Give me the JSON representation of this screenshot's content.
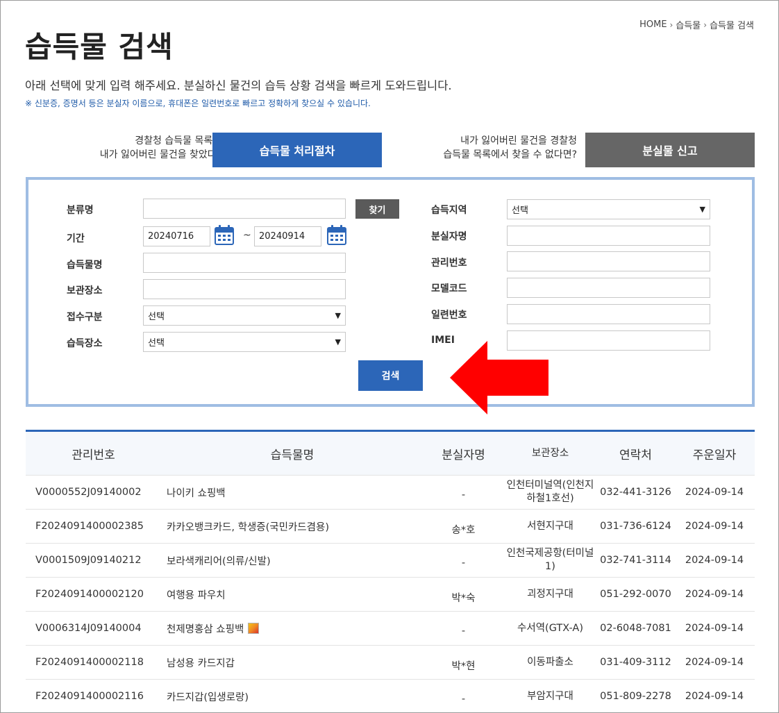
{
  "breadcrumb": [
    "HOME",
    "습득물",
    "습득물 검색"
  ],
  "page_title": "습득물 검색",
  "description": "아래 선택에 맞게 입력 해주세요. 분실하신 물건의 습득 상황 검색을 빠르게 도와드립니다.",
  "notice": "※ 신분증, 증명서 등은 분실자 이름으로, 휴대폰은 일련번호로 빠르고 정확하게 찾으실 수 있습니다.",
  "cta": {
    "left_text_1": "경찰청 습득물 목록에서",
    "left_text_2": "내가 잃어버린 물건을 찾았다면?",
    "left_button": "습득물 처리절차",
    "right_text_1": "내가 잃어버린 물건을 경찰청",
    "right_text_2": "습득물 목록에서 찾을 수 없다면?",
    "right_button": "분실물 신고"
  },
  "form": {
    "category_label": "분류명",
    "category_value": "",
    "find_button": "찾기",
    "period_label": "기간",
    "date_from": "20240716",
    "date_sep": "~",
    "date_to": "20240914",
    "item_name_label": "습득물명",
    "storage_label": "보관장소",
    "receipt_type_label": "접수구분",
    "receipt_type_value": "선택",
    "found_place_label": "습득장소",
    "found_place_value": "선택",
    "region_label": "습득지역",
    "region_value": "선택",
    "owner_label": "분실자명",
    "mgmt_no_label": "관리번호",
    "model_code_label": "모델코드",
    "serial_label": "일련번호",
    "imei_label": "IMEI",
    "search_button": "검색"
  },
  "table": {
    "headers": [
      "관리번호",
      "습득물명",
      "분실자명",
      "보관장소",
      "연락처",
      "주운일자"
    ],
    "rows": [
      {
        "id": "V0000552J09140002",
        "name": "나이키 쇼핑백",
        "owner": "-",
        "place": "인천터미널역(인천지하철1호선)",
        "phone": "032-441-3126",
        "date": "2024-09-14",
        "has_image": false
      },
      {
        "id": "F2024091400002385",
        "name": "카카오뱅크카드, 학생증(국민카드겸용)",
        "owner": "송*호",
        "place": "서현지구대",
        "phone": "031-736-6124",
        "date": "2024-09-14",
        "has_image": false
      },
      {
        "id": "V0001509J09140212",
        "name": "보라색캐리어(의류/신발)",
        "owner": "-",
        "place": "인천국제공항(터미널1)",
        "phone": "032-741-3114",
        "date": "2024-09-14",
        "has_image": false
      },
      {
        "id": "F2024091400002120",
        "name": "여행용 파우치",
        "owner": "박*숙",
        "place": "괴정지구대",
        "phone": "051-292-0070",
        "date": "2024-09-14",
        "has_image": false
      },
      {
        "id": "V0006314J09140004",
        "name": "천제명홍삼 쇼핑백",
        "owner": "-",
        "place": "수서역(GTX-A)",
        "phone": "02-6048-7081",
        "date": "2024-09-14",
        "has_image": true
      },
      {
        "id": "F2024091400002118",
        "name": "남성용 카드지갑",
        "owner": "박*현",
        "place": "이동파출소",
        "phone": "031-409-3112",
        "date": "2024-09-14",
        "has_image": false
      },
      {
        "id": "F2024091400002116",
        "name": "카드지갑(입생로랑)",
        "owner": "-",
        "place": "부암지구대",
        "phone": "051-809-2278",
        "date": "2024-09-14",
        "has_image": false
      }
    ]
  },
  "colors": {
    "primary_blue": "#2c66b8",
    "gray_button": "#666666",
    "box_border": "#9fbde3",
    "annotation_arrow": "#ff0000"
  }
}
